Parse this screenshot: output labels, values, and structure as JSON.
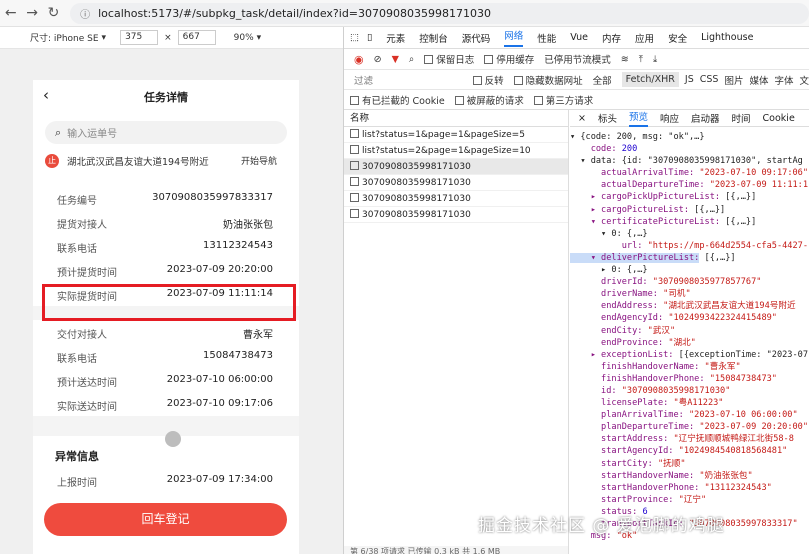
{
  "browser": {
    "url": "localhost:5173/#/subpkg_task/detail/index?id=3070908035998171030"
  },
  "device_toolbar": {
    "size_label": "尺寸: iPhone SE",
    "width": "375",
    "height": "667",
    "zoom": "90%"
  },
  "app": {
    "title": "任务详情",
    "search_placeholder": "输入运单号",
    "stop_badge": "止",
    "address": "湖北武汉武昌友谊大道194号附近",
    "start_nav": "开始导航",
    "pickup_rows": [
      {
        "label": "任务编号",
        "value": "3070908035997833317"
      },
      {
        "label": "提货对接人",
        "value": "奶油张张包"
      },
      {
        "label": "联系电话",
        "value": "13112324543"
      },
      {
        "label": "预计提货时间",
        "value": "2023-07-09 20:20:00"
      },
      {
        "label": "实际提货时间",
        "value": "2023-07-09 11:11:14"
      }
    ],
    "delivery_rows": [
      {
        "label": "交付对接人",
        "value": "曹永军"
      },
      {
        "label": "联系电话",
        "value": "15084738473"
      },
      {
        "label": "预计送达时间",
        "value": "2023-07-10 06:00:00"
      },
      {
        "label": "实际送达时间",
        "value": "2023-07-10 09:17:06"
      }
    ],
    "exception_title": "异常信息",
    "exception_rows": [
      {
        "label": "上报时间",
        "value": "2023-07-09 17:34:00"
      }
    ],
    "return_button": "回车登记"
  },
  "devtools": {
    "tabs": [
      "元素",
      "控制台",
      "源代码",
      "网络",
      "性能",
      "Vue",
      "内存",
      "应用",
      "安全",
      "Lighthouse"
    ],
    "active_tab": "网络",
    "controls": {
      "preserve_log": "保留日志",
      "disable_cache": "停用缓存",
      "throttle": "已停用节流模式"
    },
    "filter": {
      "label": "过滤",
      "invert": "反转",
      "hide_data_url": "隐藏数据网址",
      "all": "全部",
      "fetch": "Fetch/XHR",
      "js": "JS",
      "css": "CSS",
      "img": "图片",
      "media": "媒体",
      "font": "字体",
      "doc": "文"
    },
    "options": {
      "blocked_cookies": "有已拦截的 Cookie",
      "blocked_requests": "被屏蔽的请求",
      "third_party": "第三方请求"
    },
    "requests_header": "名称",
    "requests": [
      "list?status=1&page=1&pageSize=5",
      "list?status=2&page=1&pageSize=10",
      "3070908035998171030",
      "3070908035998171030",
      "3070908035998171030",
      "3070908035998171030"
    ],
    "footer": "第 6/38 项请求   已传输 0.3 kB   共 1.6 MB",
    "detail_tabs": [
      "标头",
      "预览",
      "响应",
      "启动器",
      "时间",
      "Cookie"
    ],
    "detail_active": "预览"
  },
  "json_preview": [
    {
      "t": "▾ {code: 200, msg: \"ok\",…}",
      "c": "d"
    },
    {
      "t": "    code: 200",
      "c": "n"
    },
    {
      "t": "  ▾ data: {id: \"3070908035998171030\", startAg",
      "c": "d"
    },
    {
      "t": "      actualArrivalTime: \"2023-07-10 09:17:06\"",
      "c": "s"
    },
    {
      "t": "      actualDepartureTime: \"2023-07-09 11:11:1",
      "c": "s"
    },
    {
      "t": "    ▸ cargoPickUpPictureList: [{,…}]",
      "c": "k"
    },
    {
      "t": "    ▸ cargoPictureList: [{,…}]",
      "c": "k"
    },
    {
      "t": "    ▾ certificatePictureList: [{,…}]",
      "c": "k"
    },
    {
      "t": "      ▾ 0: {,…}",
      "c": "d"
    },
    {
      "t": "          url: \"https://mp-664d2554-cfa5-4427-",
      "c": "s"
    },
    {
      "t": "    ▾ deliverPictureList: [{,…}]",
      "c": "h"
    },
    {
      "t": "      ▸ 0: {,…}",
      "c": "d"
    },
    {
      "t": "      driverId: \"3070908035977857767\"",
      "c": "s"
    },
    {
      "t": "      driverName: \"司机\"",
      "c": "s"
    },
    {
      "t": "      endAddress: \"湖北武汉武昌友谊大道194号附近",
      "c": "s"
    },
    {
      "t": "      endAgencyId: \"1024993422324415489\"",
      "c": "s"
    },
    {
      "t": "      endCity: \"武汉\"",
      "c": "s"
    },
    {
      "t": "      endProvince: \"湖北\"",
      "c": "s"
    },
    {
      "t": "    ▸ exceptionList: [{exceptionTime: \"2023-07",
      "c": "k"
    },
    {
      "t": "      finishHandoverName: \"曹永军\"",
      "c": "s"
    },
    {
      "t": "      finishHandoverPhone: \"15084738473\"",
      "c": "s"
    },
    {
      "t": "      id: \"3070908035998171030\"",
      "c": "s"
    },
    {
      "t": "      licensePlate: \"粤A11223\"",
      "c": "s"
    },
    {
      "t": "      planArrivalTime: \"2023-07-10 06:00:00\"",
      "c": "s"
    },
    {
      "t": "      planDepartureTime: \"2023-07-09 20:20:00\"",
      "c": "s"
    },
    {
      "t": "      startAddress: \"辽宁抚顺顺城鸭绿江北街58-8",
      "c": "s"
    },
    {
      "t": "      startAgencyId: \"1024984540818568481\"",
      "c": "s"
    },
    {
      "t": "      startCity: \"抚顺\"",
      "c": "s"
    },
    {
      "t": "      startHandoverName: \"奶油张张包\"",
      "c": "s"
    },
    {
      "t": "      startHandoverPhone: \"13112324543\"",
      "c": "s"
    },
    {
      "t": "      startProvince: \"辽宁\"",
      "c": "s"
    },
    {
      "t": "      status: 6",
      "c": "n"
    },
    {
      "t": "      transportTaskId: \"3070908035997833317\"",
      "c": "s"
    },
    {
      "t": "    msg: \"ok\"",
      "c": "s"
    }
  ],
  "watermark": "掘金技术社区 @ 爱泡脚的鸡腿"
}
